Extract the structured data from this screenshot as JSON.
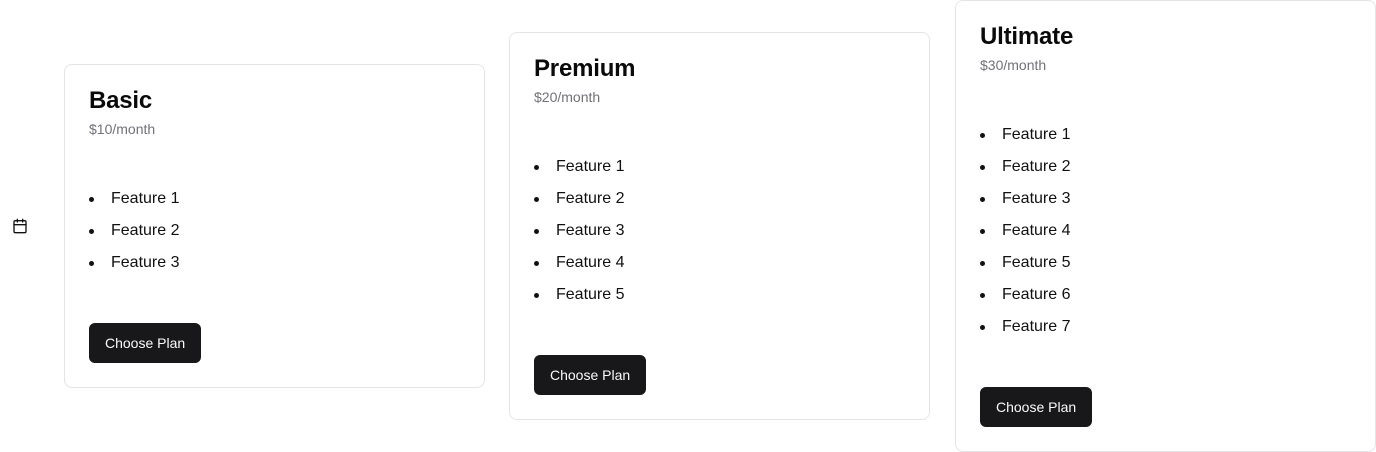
{
  "sidebar": {
    "icon": "calendar-icon"
  },
  "plans": [
    {
      "title": "Basic",
      "price": "$10/month",
      "features": [
        "Feature 1",
        "Feature 2",
        "Feature 3"
      ],
      "button_label": "Choose Plan"
    },
    {
      "title": "Premium",
      "price": "$20/month",
      "features": [
        "Feature 1",
        "Feature 2",
        "Feature 3",
        "Feature 4",
        "Feature 5"
      ],
      "button_label": "Choose Plan"
    },
    {
      "title": "Ultimate",
      "price": "$30/month",
      "features": [
        "Feature 1",
        "Feature 2",
        "Feature 3",
        "Feature 4",
        "Feature 5",
        "Feature 6",
        "Feature 7"
      ],
      "button_label": "Choose Plan"
    }
  ],
  "colors": {
    "button_bg": "#18181b",
    "button_text": "#fafafa",
    "card_border": "#e4e4e7",
    "muted_text": "#71717a"
  }
}
